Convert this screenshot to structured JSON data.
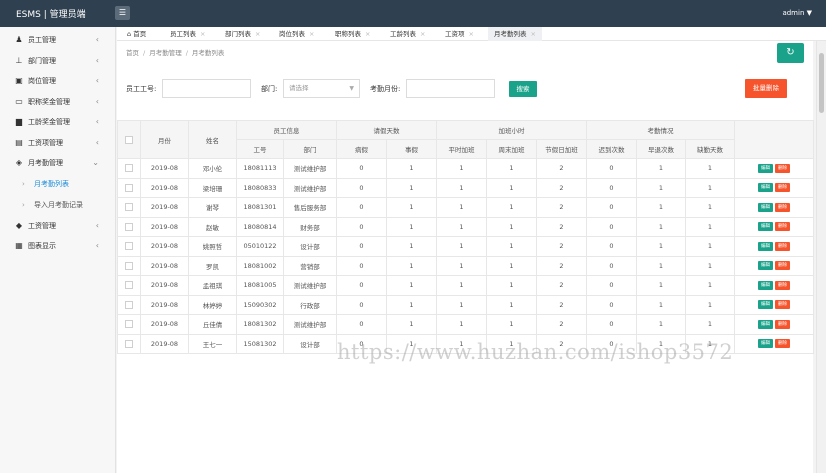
{
  "app": {
    "brand": "ESMS | 管理员端",
    "user": "admin ▼"
  },
  "colors": {
    "primary": "#1aa38a",
    "danger": "#f5542d",
    "topbar": "#2f4050",
    "link": "#1a8bd8"
  },
  "sidebar": {
    "items": [
      {
        "label": "员工管理",
        "icon": "users-icon"
      },
      {
        "label": "部门管理",
        "icon": "sitemap-icon"
      },
      {
        "label": "岗位管理",
        "icon": "post-icon"
      },
      {
        "label": "职称奖金管理",
        "icon": "briefcase-icon"
      },
      {
        "label": "工龄奖金管理",
        "icon": "bar-chart-icon"
      },
      {
        "label": "工资项管理",
        "icon": "money-icon"
      },
      {
        "label": "月考勤管理",
        "icon": "layers-icon"
      },
      {
        "label": "工资管理",
        "icon": "tag-icon"
      },
      {
        "label": "图表显示",
        "icon": "report-icon"
      }
    ],
    "subitems": [
      {
        "label": "月考勤列表"
      },
      {
        "label": "导入月考勤记录"
      }
    ]
  },
  "tabs": [
    {
      "label": "首页"
    },
    {
      "label": "员工列表"
    },
    {
      "label": "部门列表"
    },
    {
      "label": "岗位列表"
    },
    {
      "label": "职称列表"
    },
    {
      "label": "工龄列表"
    },
    {
      "label": "工资项"
    },
    {
      "label": "月考勤列表"
    }
  ],
  "breadcrumb": {
    "home": "首页",
    "section": "月考勤管理",
    "page": "月考勤列表",
    "sep": "/"
  },
  "search": {
    "emp_no_label": "员工工号:",
    "dept_label": "部门:",
    "dept_value": "请选择",
    "month_label": "考勤月份:",
    "search_btn": "搜索",
    "batch_delete_btn": "批量删除"
  },
  "table": {
    "headers": {
      "month": "月份",
      "name": "姓名",
      "emp_info": "员工信息",
      "emp_no": "工号",
      "dept": "部门",
      "leave": "请假天数",
      "sick": "病假",
      "personal": "事假",
      "overtime": "加班小时",
      "weekday_ot": "平时加班",
      "weekend_ot": "周末加班",
      "holiday_ot": "节假日加班",
      "attendance": "考勤情况",
      "late": "迟到次数",
      "early": "早退次数",
      "absent": "缺勤天数"
    },
    "edit_label": "编辑",
    "delete_label": "删除",
    "rows": [
      {
        "month": "2019-08",
        "name": "邓小伦",
        "emp_no": "18081113",
        "dept": "测试维护部",
        "sick": "0",
        "personal": "1",
        "weekday_ot": "1",
        "weekend_ot": "1",
        "holiday_ot": "2",
        "late": "0",
        "early": "1",
        "absent": "1"
      },
      {
        "month": "2019-08",
        "name": "梁培珊",
        "emp_no": "18080833",
        "dept": "测试维护部",
        "sick": "0",
        "personal": "1",
        "weekday_ot": "1",
        "weekend_ot": "1",
        "holiday_ot": "2",
        "late": "0",
        "early": "1",
        "absent": "1"
      },
      {
        "month": "2019-08",
        "name": "谢琴",
        "emp_no": "18081301",
        "dept": "售后服务部",
        "sick": "0",
        "personal": "1",
        "weekday_ot": "1",
        "weekend_ot": "1",
        "holiday_ot": "2",
        "late": "0",
        "early": "1",
        "absent": "1"
      },
      {
        "month": "2019-08",
        "name": "赵敏",
        "emp_no": "18080814",
        "dept": "财务部",
        "sick": "0",
        "personal": "1",
        "weekday_ot": "1",
        "weekend_ot": "1",
        "holiday_ot": "2",
        "late": "0",
        "early": "1",
        "absent": "1"
      },
      {
        "month": "2019-08",
        "name": "姚照哲",
        "emp_no": "05010122",
        "dept": "设计部",
        "sick": "0",
        "personal": "1",
        "weekday_ot": "1",
        "weekend_ot": "1",
        "holiday_ot": "2",
        "late": "0",
        "early": "1",
        "absent": "1"
      },
      {
        "month": "2019-08",
        "name": "罗凯",
        "emp_no": "18081002",
        "dept": "营销部",
        "sick": "0",
        "personal": "1",
        "weekday_ot": "1",
        "weekend_ot": "1",
        "holiday_ot": "2",
        "late": "0",
        "early": "1",
        "absent": "1"
      },
      {
        "month": "2019-08",
        "name": "孟祖琪",
        "emp_no": "18081005",
        "dept": "测试维护部",
        "sick": "0",
        "personal": "1",
        "weekday_ot": "1",
        "weekend_ot": "1",
        "holiday_ot": "2",
        "late": "0",
        "early": "1",
        "absent": "1"
      },
      {
        "month": "2019-08",
        "name": "林婷婷",
        "emp_no": "15090302",
        "dept": "行政部",
        "sick": "0",
        "personal": "1",
        "weekday_ot": "1",
        "weekend_ot": "1",
        "holiday_ot": "2",
        "late": "0",
        "early": "1",
        "absent": "1"
      },
      {
        "month": "2019-08",
        "name": "丘佳倩",
        "emp_no": "18081302",
        "dept": "测试维护部",
        "sick": "0",
        "personal": "1",
        "weekday_ot": "1",
        "weekend_ot": "1",
        "holiday_ot": "2",
        "late": "0",
        "early": "1",
        "absent": "1"
      },
      {
        "month": "2019-08",
        "name": "王七一",
        "emp_no": "15081302",
        "dept": "设计部",
        "sick": "0",
        "personal": "1",
        "weekday_ot": "1",
        "weekend_ot": "1",
        "holiday_ot": "2",
        "late": "0",
        "early": "1",
        "absent": "1"
      }
    ]
  },
  "watermark": "https://www.huzhan.com/ishop3572"
}
